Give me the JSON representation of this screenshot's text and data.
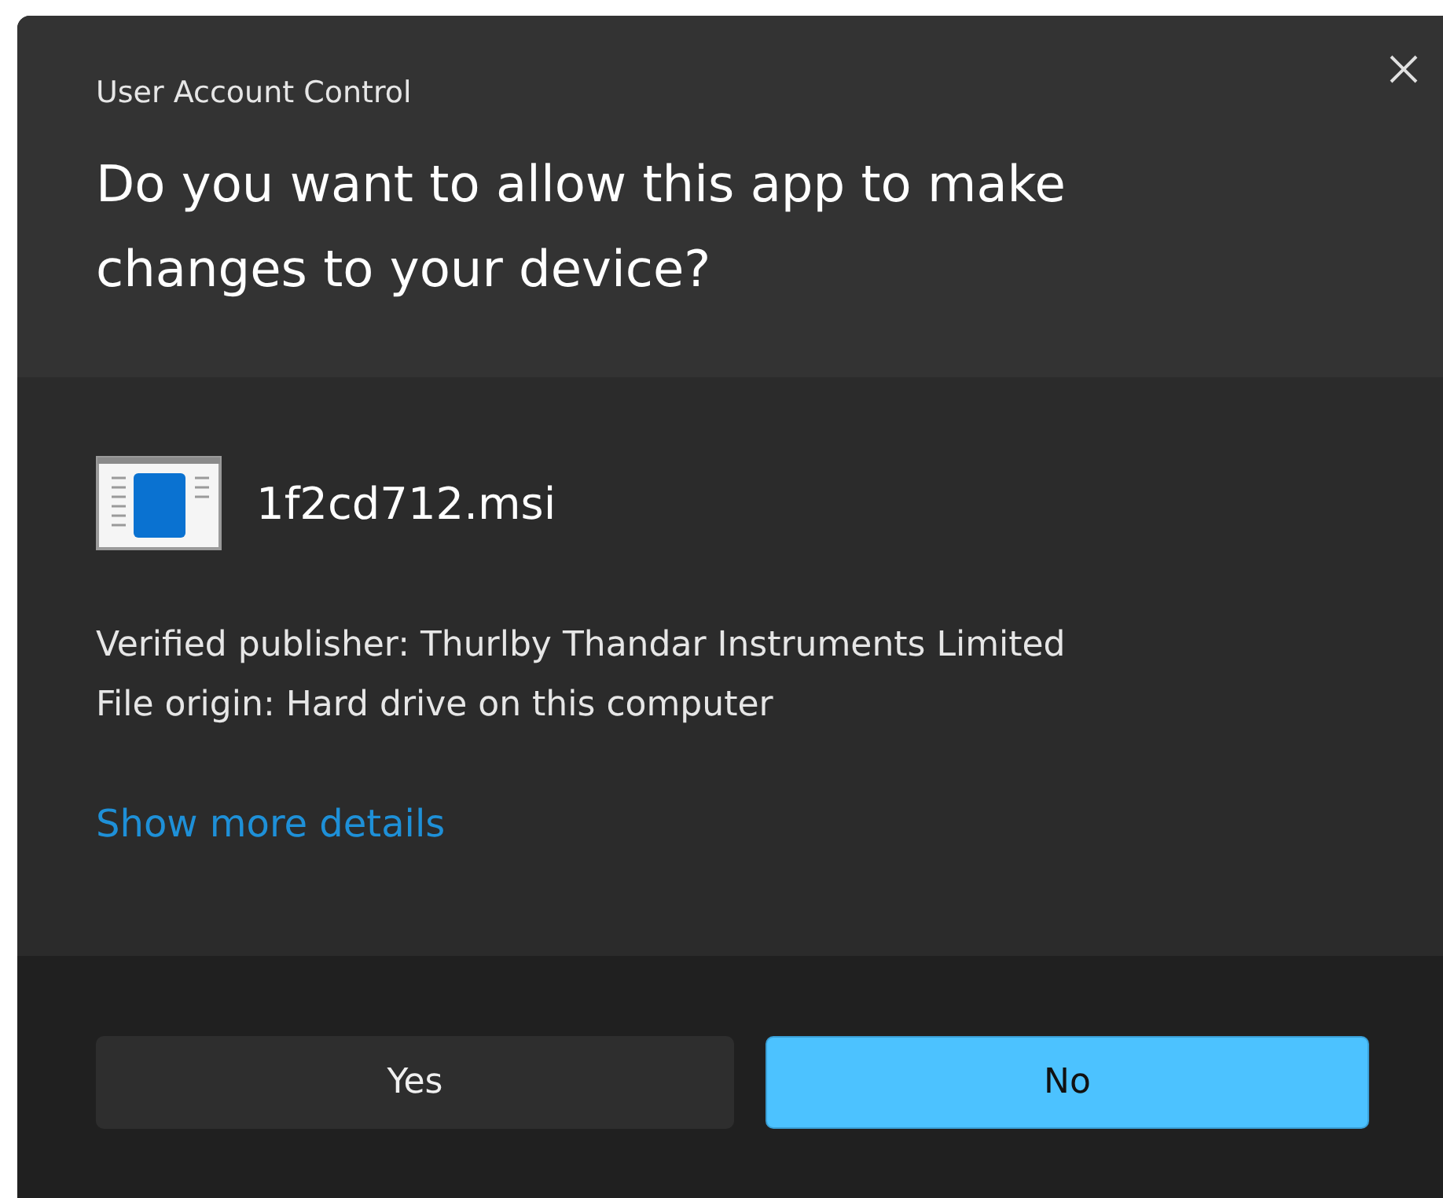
{
  "window": {
    "title": "User Account Control"
  },
  "question": "Do you want to allow this app to make changes to your device?",
  "program": {
    "name": "1f2cd712.msi"
  },
  "details": [
    "Verified publisher: Thurlby Thandar Instruments Limited",
    "File origin: Hard drive on this computer"
  ],
  "more_link": "Show more details",
  "buttons": [
    {
      "label": "Yes",
      "default": false
    },
    {
      "label": "No",
      "default": true
    }
  ]
}
